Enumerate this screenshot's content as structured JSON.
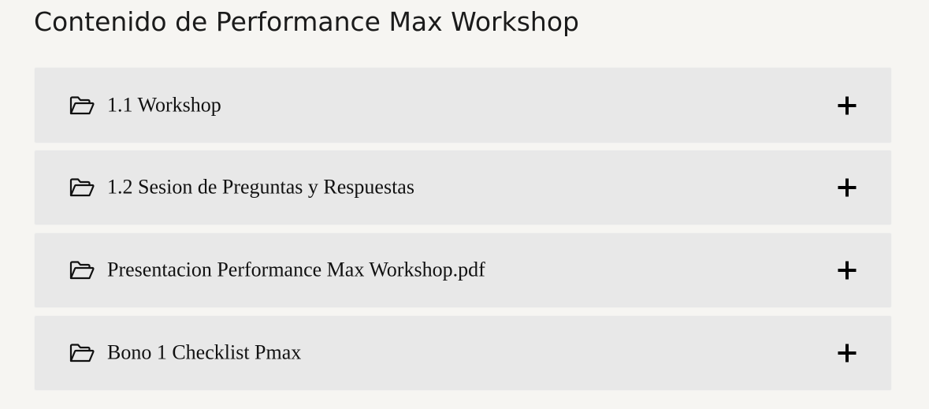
{
  "page": {
    "title": "Contenido de Performance Max Workshop"
  },
  "accordion": {
    "items": [
      {
        "label": "1.1 Workshop",
        "icon": "folder-open-icon",
        "toggle_icon": "plus-icon",
        "expanded": false
      },
      {
        "label": "1.2 Sesion de Preguntas y Respuestas",
        "icon": "folder-open-icon",
        "toggle_icon": "plus-icon",
        "expanded": false
      },
      {
        "label": "Presentacion Performance Max Workshop.pdf",
        "icon": "folder-open-icon",
        "toggle_icon": "plus-icon",
        "expanded": false
      },
      {
        "label": "Bono 1 Checklist Pmax",
        "icon": "folder-open-icon",
        "toggle_icon": "plus-icon",
        "expanded": false
      }
    ]
  },
  "colors": {
    "page_background": "#f6f5f2",
    "item_background": "#e8e8e8",
    "text": "#111111"
  }
}
